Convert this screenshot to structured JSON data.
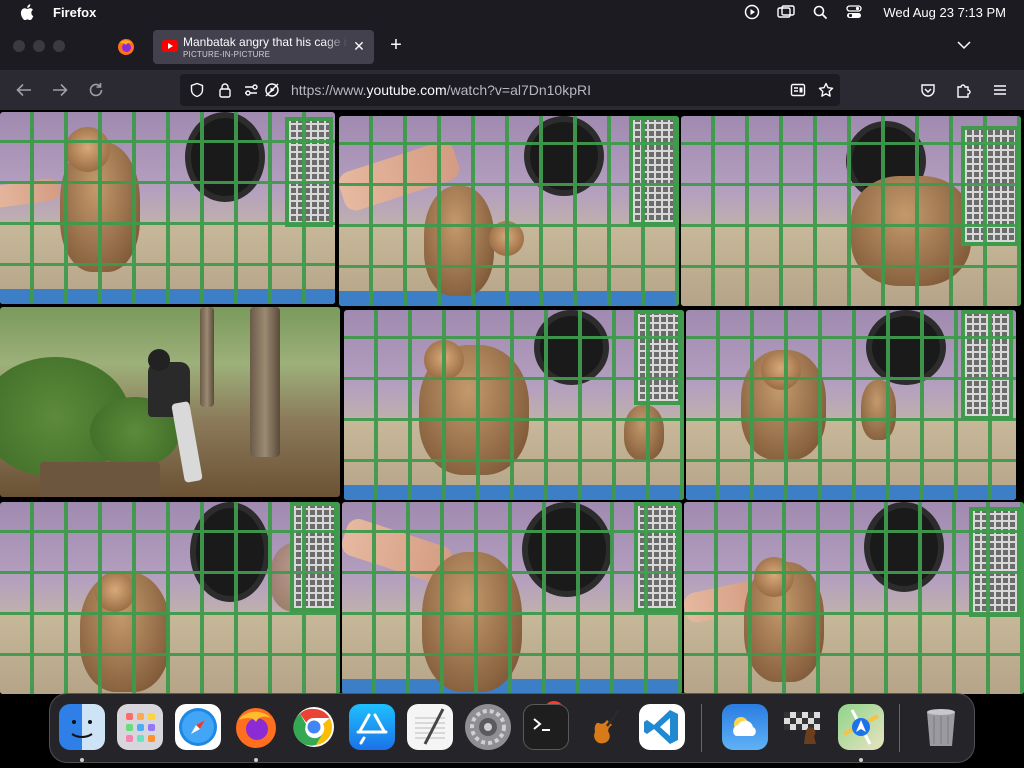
{
  "menubar": {
    "app_name": "Firefox",
    "clock": "Wed Aug 23  7:13 PM"
  },
  "browser": {
    "tab": {
      "title": "Manbatak angry that his cage is",
      "subtitle": "PICTURE-IN-PICTURE"
    },
    "url": {
      "prefix": "https://www.",
      "domain": "youtube.com",
      "path": "/watch?v=al7Dn10kpRI"
    }
  },
  "dock": {
    "apps": [
      "finder-icon",
      "launchpad-icon",
      "safari-icon",
      "firefox-icon",
      "chrome-icon",
      "app-store-icon",
      "textedit-icon",
      "system-settings-icon",
      "terminal-icon",
      "garageband-icon",
      "vscode-icon",
      "weather-icon",
      "chess-icon",
      "maps-icon",
      "trash-icon"
    ],
    "settings_badge": "2",
    "colors": {
      "finder": "#2f7fe8",
      "safari": "#1e88e5",
      "chrome": "#34a853",
      "app_store": "#1b8df2",
      "vscode": "#1f8ad2"
    }
  }
}
